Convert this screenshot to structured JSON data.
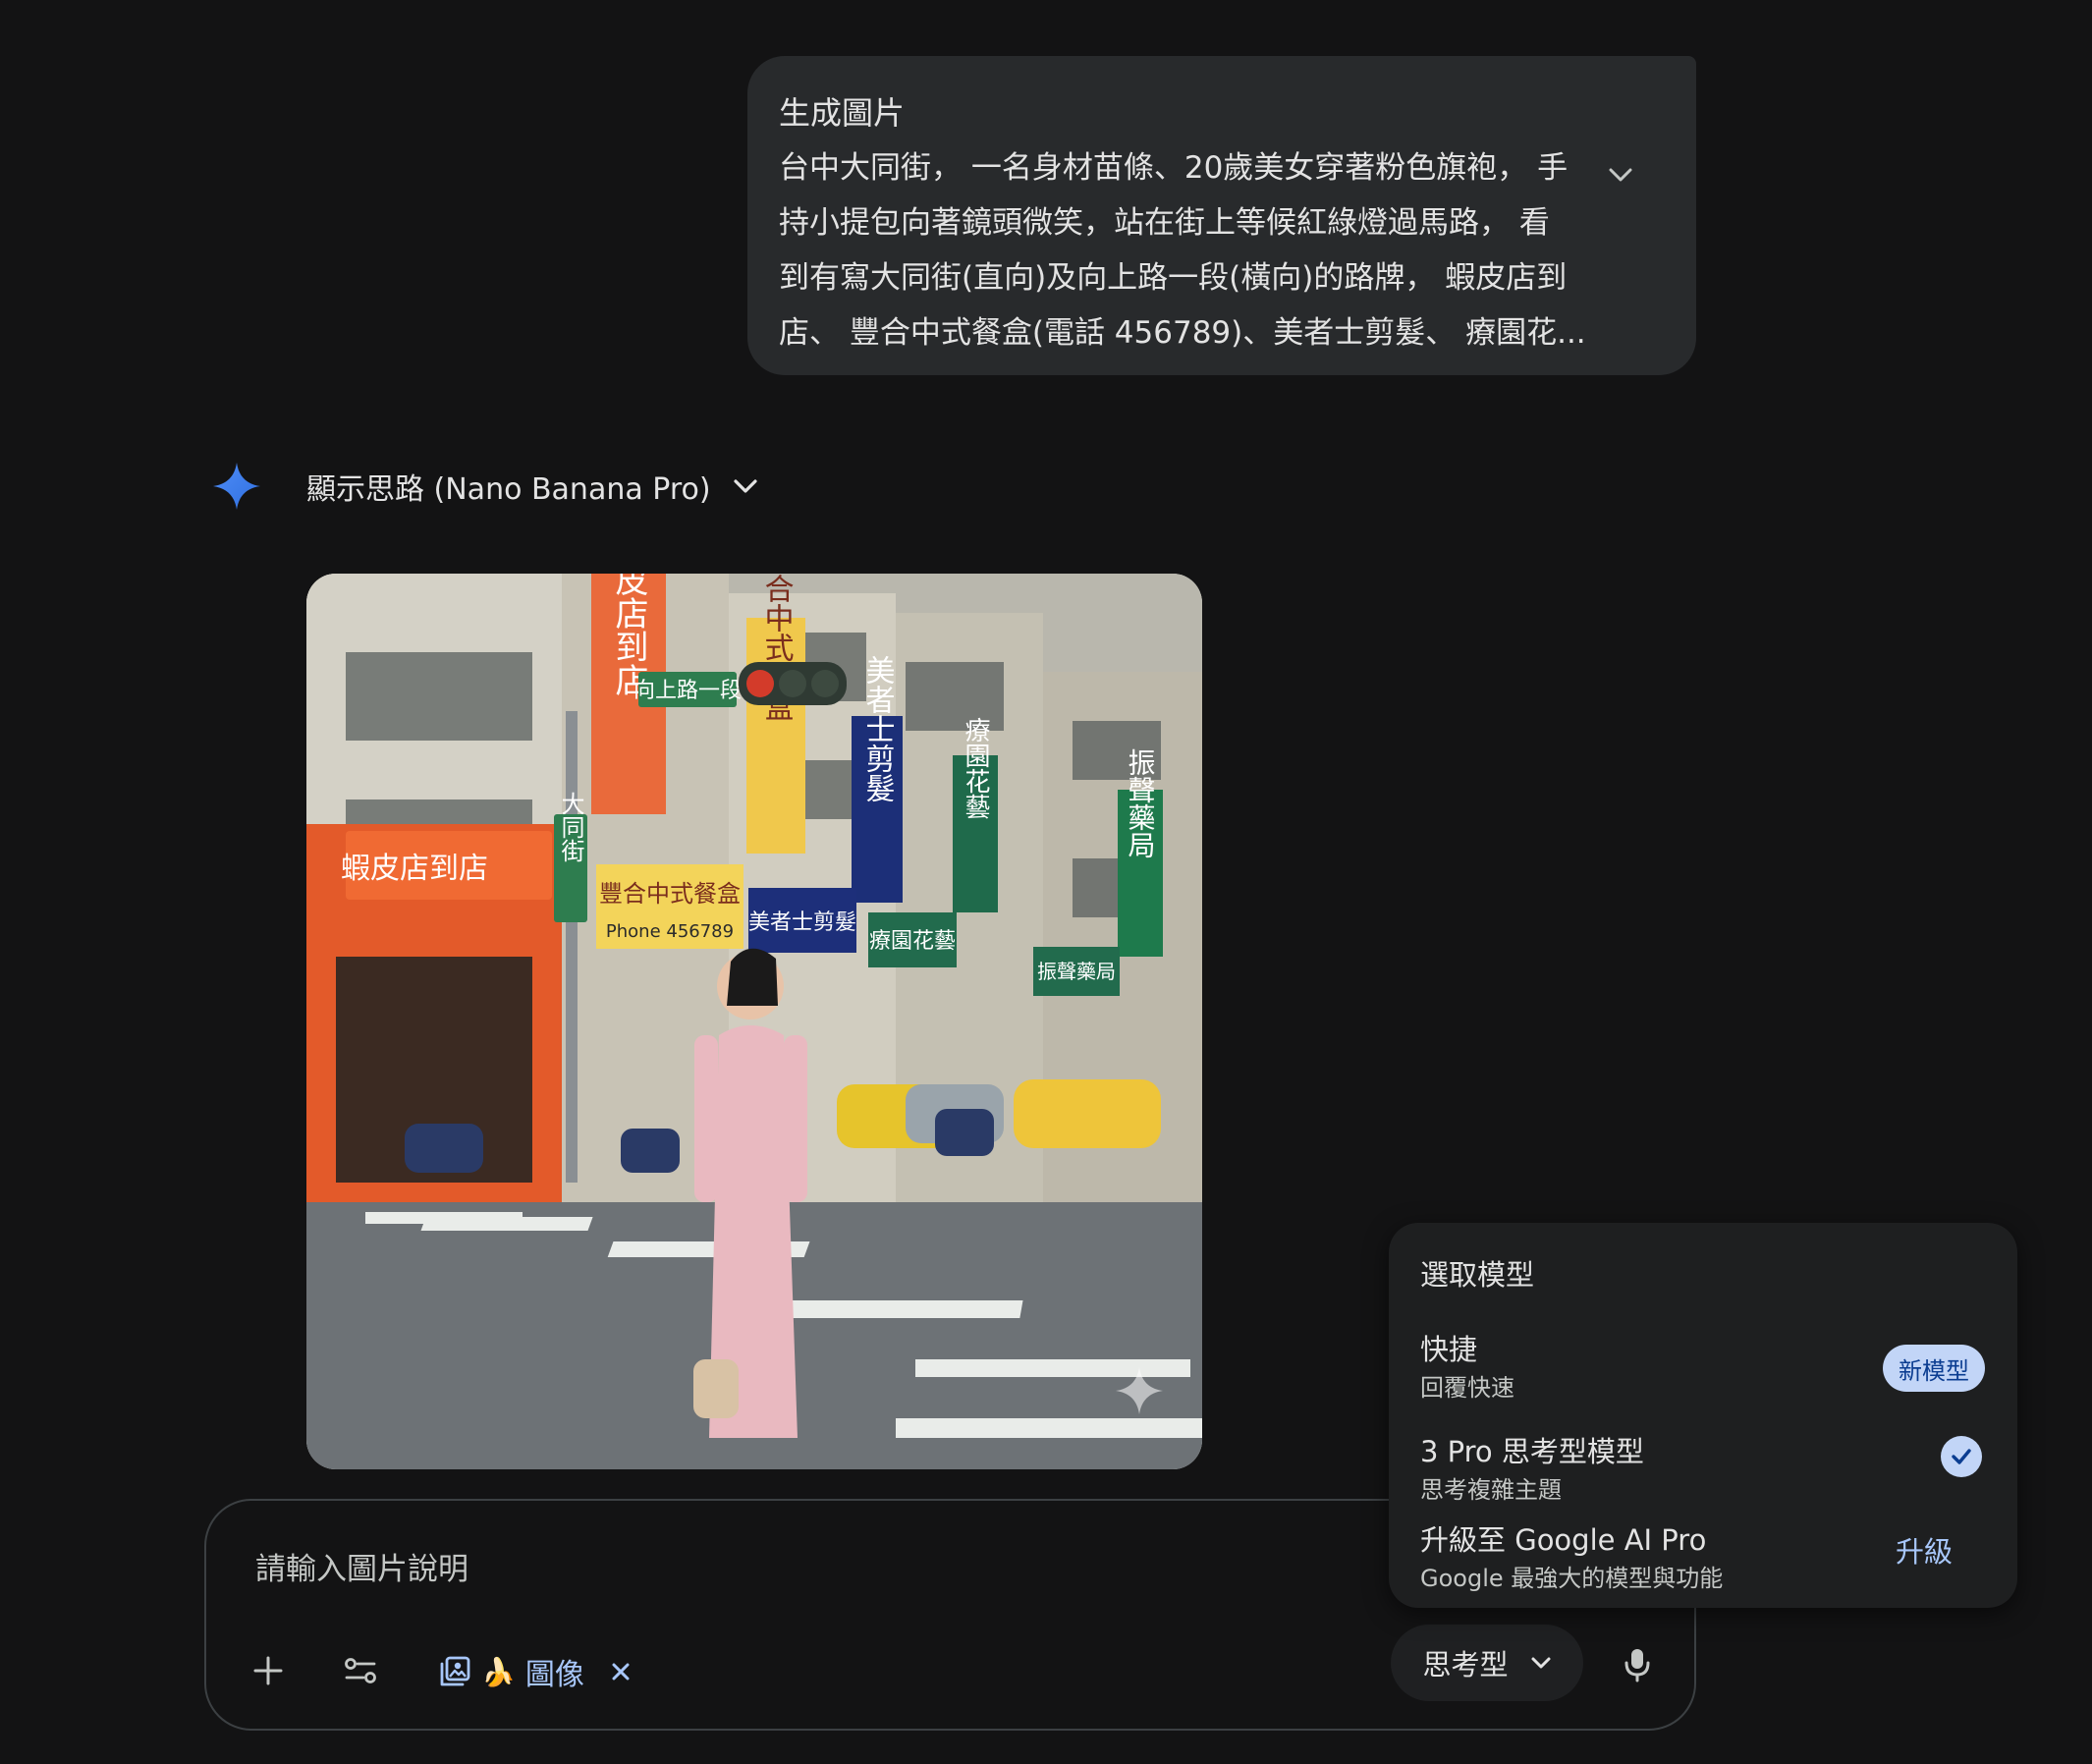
{
  "prompt": {
    "title": "生成圖片",
    "body": "台中大同街， 一名身材苗條、20歲美女穿著粉色旗袍， 手\n持小提包向著鏡頭微笑，站在街上等候紅綠燈過馬路， 看\n到有寫大同街(直向)及向上路一段(橫向)的路牌， 蝦皮店到\n店、 豐合中式餐盒(電話 456789)、美者士剪髮、 療園花..."
  },
  "response": {
    "thinking_label": "顯示思路 (Nano Banana Pro)"
  },
  "image": {
    "signs": {
      "shopee_vertical": "蝦皮店到店",
      "shopee_storefront": "蝦皮店到店",
      "road_sign_horizontal": "向上路一段",
      "road_sign_vertical": "大同街",
      "bento_vertical": "豐合中式餐盒",
      "bento_horizontal": "豐合中式餐盒",
      "bento_phone": "Phone 456789",
      "barber_vertical": "美者士剪髮",
      "barber_horizontal": "美者士剪髮",
      "florist_vertical": "療園花藝",
      "florist_horizontal": "療園花藝",
      "pharmacy_vertical": "振聲藥局",
      "pharmacy_horizontal": "振聲藥局"
    }
  },
  "input": {
    "placeholder": "請輸入圖片說明",
    "chip_label": "圖像",
    "chip_emoji": "🍌",
    "model_button": "思考型"
  },
  "model_menu": {
    "title": "選取模型",
    "items": [
      {
        "name": "快捷",
        "desc": "回覆快速",
        "badge": "新模型"
      },
      {
        "name": "3 Pro 思考型模型",
        "desc": "思考複雜主題",
        "selected": true
      },
      {
        "name": "升級至 Google AI Pro",
        "desc": "Google 最強大的模型與功能",
        "action": "升級"
      }
    ]
  },
  "colors": {
    "background": "#131314",
    "bubble": "#282a2c",
    "accent_blue": "#a8c7fa",
    "badge": "#c2d5f7"
  }
}
